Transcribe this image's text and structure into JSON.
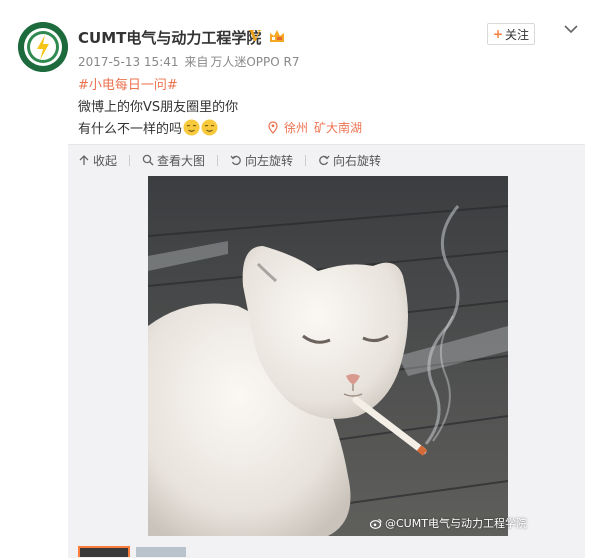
{
  "post": {
    "username": "CUMT电气与动力工程学院",
    "verified_mark": "V",
    "date": "2017-5-13 15:41",
    "source_prefix": "来自",
    "source": "万人迷OPPO R7",
    "follow_label": "关注",
    "topic": "#小电每日一问#",
    "text_line1": "微博上的你VS朋友圈里的你",
    "text_line2": "有什么不一样的吗",
    "location_city": "徐州",
    "location_place": "矿大南湖"
  },
  "toolbar": {
    "collapse": "收起",
    "view_large": "查看大图",
    "rotate_left": "向左旋转",
    "rotate_right": "向右旋转"
  },
  "image": {
    "watermark": "@CUMT电气与动力工程学院",
    "alt": "white cat smoking a cigarette on wooden deck"
  },
  "colors": {
    "accent_orange": "#eb7350",
    "follow_plus": "#fa7d3c",
    "verified_gold": "#e8a21a",
    "media_bg": "#f2f2f5"
  }
}
